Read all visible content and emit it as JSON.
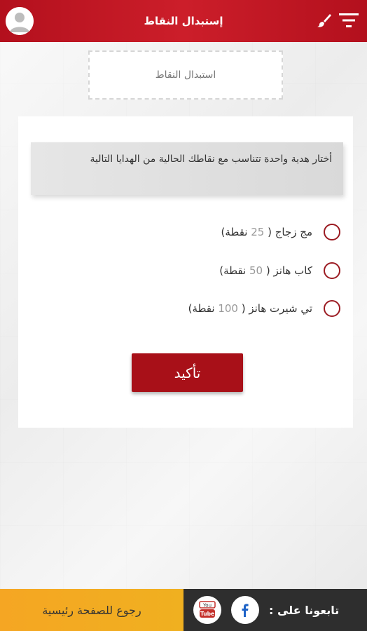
{
  "header": {
    "title": "إستبدال النقاط",
    "menu_icon": "filter-menu-icon",
    "brush_icon": "brush-icon",
    "avatar_icon": "user-avatar-icon"
  },
  "top_box": {
    "label": "استبدال النقاط"
  },
  "card": {
    "notice": "أختار هدية واحدة تتناسب مع نقاطك الحالية من الهدايا التالية",
    "options": [
      {
        "name": "مج زجاج",
        "points": "25",
        "unit": "نقطة"
      },
      {
        "name": "كاب هانز",
        "points": "50",
        "unit": "نقطة"
      },
      {
        "name": "تي شيرت هانز",
        "points": "100",
        "unit": "نقطة"
      }
    ],
    "confirm_label": "تأكيد"
  },
  "footer": {
    "back_label": "رجوع للصفحة رئيسية",
    "follow_label": "تابعونا على :",
    "facebook_icon": "facebook-icon",
    "youtube_icon": "youtube-icon"
  },
  "colors": {
    "brand_red": "#b3101d",
    "button_red": "#a81018",
    "footer_orange": "#f5a623",
    "footer_dark": "#2e2e2e"
  }
}
